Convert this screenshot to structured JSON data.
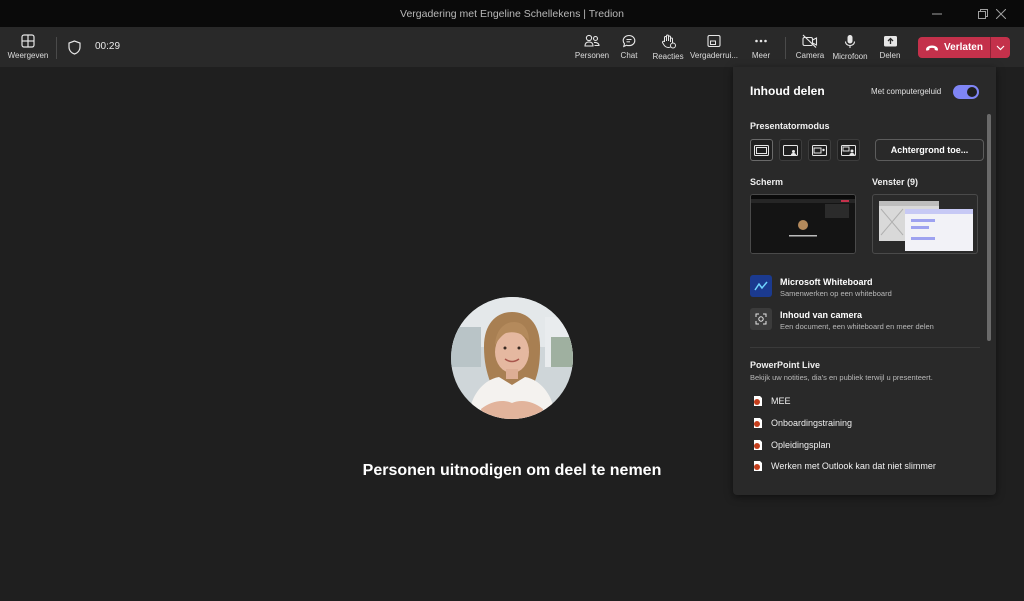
{
  "window": {
    "title": "Vergadering met Engeline Schellekens | Tredion"
  },
  "toolbar": {
    "view_label": "Weergeven",
    "timer": "00:29",
    "people_label": "Personen",
    "chat_label": "Chat",
    "reactions_label": "Reacties",
    "rooms_label": "Vergaderrui...",
    "more_label": "Meer",
    "camera_label": "Camera",
    "mic_label": "Microfoon",
    "share_label": "Delen",
    "leave_label": "Verlaten"
  },
  "stage": {
    "invite_text": "Personen uitnodigen om deel te nemen"
  },
  "share_panel": {
    "title": "Inhoud delen",
    "audio_label": "Met computergeluid",
    "audio_on": true,
    "presenter_mode_label": "Presentatormodus",
    "background_button": "Achtergrond toe...",
    "screen_label": "Scherm",
    "window_label": "Venster (9)",
    "options": [
      {
        "title": "Microsoft Whiteboard",
        "subtitle": "Samenwerken op een whiteboard",
        "icon": "whiteboard-icon"
      },
      {
        "title": "Inhoud van camera",
        "subtitle": "Een document, een whiteboard en meer delen",
        "icon": "camera-content-icon"
      }
    ],
    "powerpoint": {
      "title": "PowerPoint Live",
      "subtitle": "Bekijk uw notities, dia's en publiek terwijl u presenteert.",
      "files": [
        "MEE",
        "Onboardingstraining",
        "Opleidingsplan",
        "Werken met Outlook kan dat niet slimmer"
      ]
    }
  },
  "colors": {
    "accent": "#7f85f5",
    "leave": "#c4314b",
    "background": "#1f1f1f",
    "panel": "#292929"
  }
}
